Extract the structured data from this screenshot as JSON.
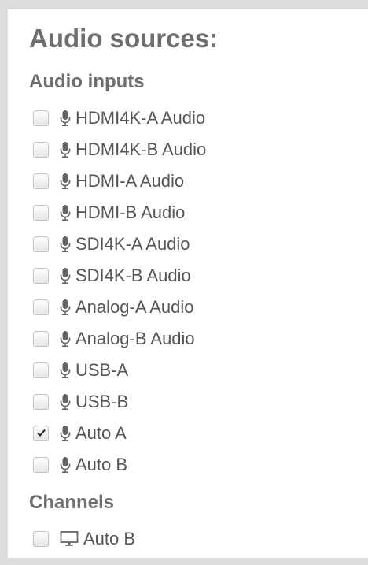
{
  "title": "Audio sources:",
  "sections": {
    "audio_inputs": {
      "heading": "Audio inputs",
      "items": [
        {
          "label": "HDMI4K-A Audio",
          "checked": false,
          "icon": "microphone-icon"
        },
        {
          "label": "HDMI4K-B Audio",
          "checked": false,
          "icon": "microphone-icon"
        },
        {
          "label": "HDMI-A Audio",
          "checked": false,
          "icon": "microphone-icon"
        },
        {
          "label": "HDMI-B Audio",
          "checked": false,
          "icon": "microphone-icon"
        },
        {
          "label": "SDI4K-A Audio",
          "checked": false,
          "icon": "microphone-icon"
        },
        {
          "label": "SDI4K-B Audio",
          "checked": false,
          "icon": "microphone-icon"
        },
        {
          "label": "Analog-A Audio",
          "checked": false,
          "icon": "microphone-icon"
        },
        {
          "label": "Analog-B Audio",
          "checked": false,
          "icon": "microphone-icon"
        },
        {
          "label": "USB-A",
          "checked": false,
          "icon": "microphone-icon"
        },
        {
          "label": "USB-B",
          "checked": false,
          "icon": "microphone-icon"
        },
        {
          "label": "Auto A",
          "checked": true,
          "icon": "microphone-icon"
        },
        {
          "label": "Auto B",
          "checked": false,
          "icon": "microphone-icon"
        }
      ]
    },
    "channels": {
      "heading": "Channels",
      "items": [
        {
          "label": "Auto B",
          "checked": false,
          "icon": "monitor-icon"
        }
      ]
    }
  },
  "colors": {
    "text": "#555555",
    "heading": "#6e6e6e",
    "background": "#ffffff",
    "frame": "#dcdcdc"
  }
}
